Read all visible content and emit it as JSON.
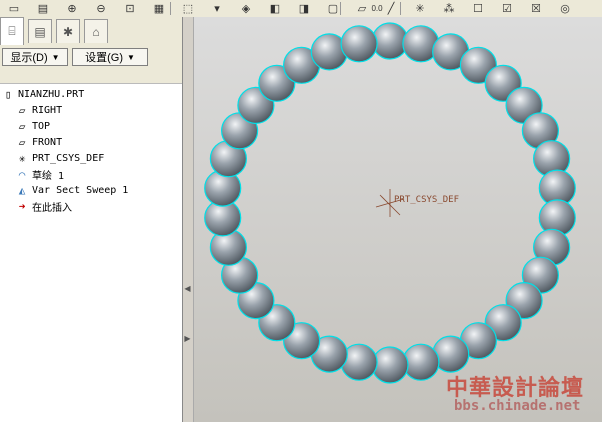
{
  "toolbar": {
    "icons": [
      "new-icon",
      "open-icon",
      "zoom-in-icon",
      "zoom-out-icon",
      "refit-icon",
      "repaint-icon",
      "orient-icon",
      "saved-views-icon",
      "shading-icon",
      "hidden-line-icon",
      "no-hidden-icon",
      "wireframe-icon",
      "datum-plane-icon",
      "axis-icon",
      "csys-icon",
      "spin-center-icon",
      "select-icon",
      "accept-icon",
      "cancel-icon",
      "preview-icon"
    ],
    "readout": "0.0"
  },
  "sidebar": {
    "tabs": [
      "model-tree-icon",
      "folder-icon",
      "favorites-icon",
      "connections-icon"
    ],
    "display_label": "显示(D)",
    "settings_label": "设置(G)",
    "tree": [
      {
        "label": "NIANZHU.PRT",
        "icon": "part-icon"
      },
      {
        "label": "RIGHT",
        "icon": "datum-plane-icon"
      },
      {
        "label": "TOP",
        "icon": "datum-plane-icon"
      },
      {
        "label": "FRONT",
        "icon": "datum-plane-icon"
      },
      {
        "label": "PRT_CSYS_DEF",
        "icon": "csys-icon"
      },
      {
        "label": "草绘 1",
        "icon": "sketch-icon"
      },
      {
        "label": "Var Sect Sweep 1",
        "icon": "sweep-icon"
      },
      {
        "label": "在此插入",
        "icon": "insert-here-icon"
      }
    ]
  },
  "viewport": {
    "csys_label": "PRT_CSYS_DEF",
    "watermark_cn": "中華設計論壇",
    "watermark_url": "bbs.chinade.net",
    "bead_count": 34,
    "colors": {
      "bead": "#9aa3ac",
      "highlight": "#00e0e8",
      "csys": "#8a4a30"
    }
  }
}
